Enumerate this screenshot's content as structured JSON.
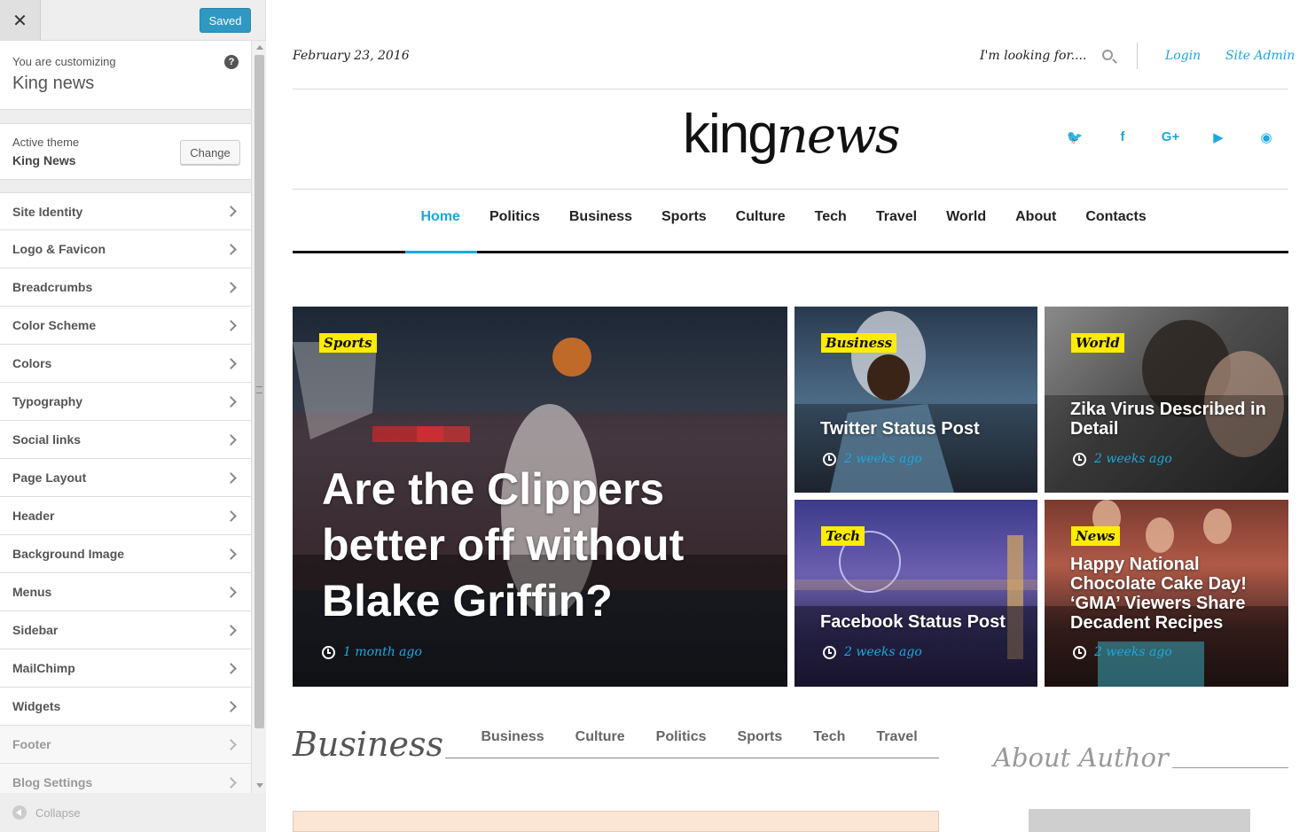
{
  "customizer": {
    "close_label": "✕",
    "saved_label": "Saved",
    "customizing_label": "You are customizing",
    "site_name": "King news",
    "help_label": "?",
    "active_theme_label": "Active theme",
    "active_theme_name": "King News",
    "change_label": "Change",
    "sections": [
      {
        "label": "Site Identity"
      },
      {
        "label": "Logo & Favicon"
      },
      {
        "label": "Breadcrumbs"
      },
      {
        "label": "Color Scheme"
      },
      {
        "label": "Colors"
      },
      {
        "label": "Typography"
      },
      {
        "label": "Social links"
      },
      {
        "label": "Page Layout"
      },
      {
        "label": "Header"
      },
      {
        "label": "Background Image"
      },
      {
        "label": "Menus"
      },
      {
        "label": "Sidebar"
      },
      {
        "label": "MailChimp"
      },
      {
        "label": "Widgets"
      },
      {
        "label": "Footer"
      },
      {
        "label": "Blog Settings"
      }
    ],
    "collapse_label": "Collapse"
  },
  "site": {
    "date": "February 23, 2016",
    "search_placeholder": "I'm looking for....",
    "login": "Login",
    "site_admin": "Site Admin",
    "logo_part1": "king",
    "logo_part2": "news",
    "social_icons": [
      "twitter-icon",
      "facebook-icon",
      "google-plus-icon",
      "youtube-icon",
      "rss-icon"
    ],
    "social_glyphs": [
      "🐦",
      "f",
      "G+",
      "▶",
      "◉"
    ],
    "nav": [
      "Home",
      "Politics",
      "Business",
      "Sports",
      "Culture",
      "Tech",
      "Travel",
      "World",
      "About",
      "Contacts"
    ],
    "accent_color": "#1ca8dd",
    "tag_color": "#ffec00"
  },
  "cards": [
    {
      "tag": "Sports",
      "title": "Are the Clippers better off without Blake Griffin?",
      "time": "1 month ago"
    },
    {
      "tag": "Business",
      "title": "Twitter Status Post",
      "time": "2 weeks ago"
    },
    {
      "tag": "World",
      "title": "Zika Virus Described in Detail",
      "time": "2 weeks ago"
    },
    {
      "tag": "Tech",
      "title": "Facebook Status Post",
      "time": "2 weeks ago"
    },
    {
      "tag": "News",
      "title": "Happy National Chocolate Cake Day! ‘GMA’ Viewers Share Decadent Recipes",
      "time": "2 weeks ago"
    }
  ],
  "business_section": {
    "title": "Business",
    "tabs": [
      "Business",
      "Culture",
      "Politics",
      "Sports",
      "Tech",
      "Travel"
    ]
  },
  "sidebar": {
    "about_title": "About Author"
  }
}
